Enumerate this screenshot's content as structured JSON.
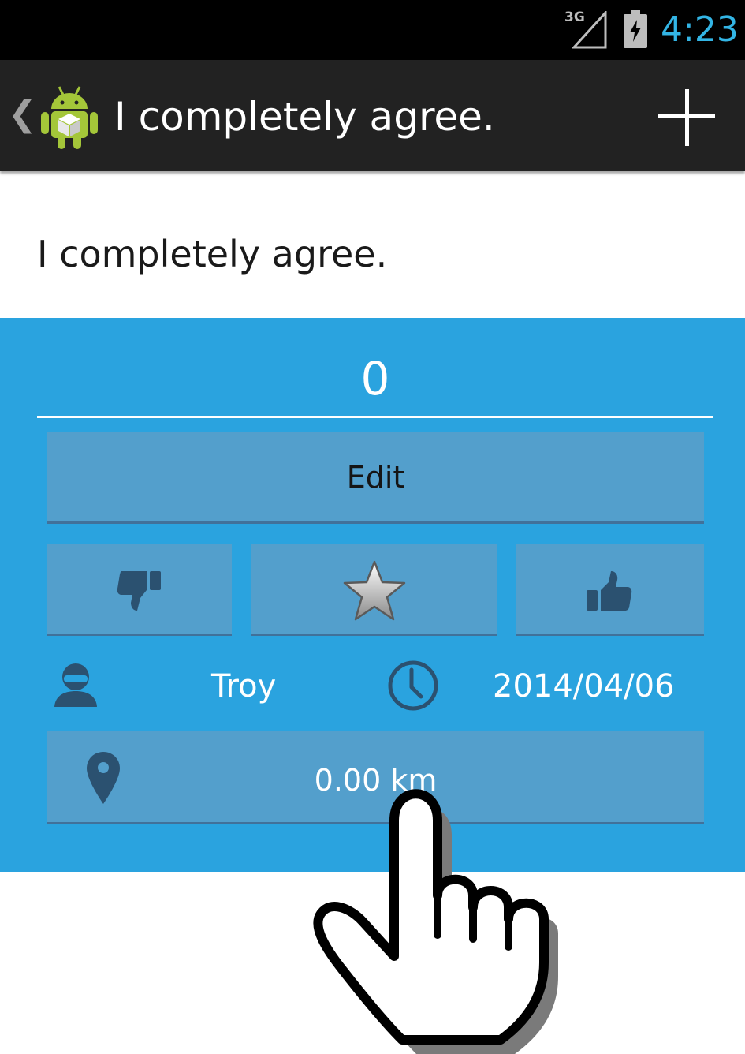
{
  "status_bar": {
    "network": "3G",
    "time": "4:23"
  },
  "action_bar": {
    "up_icon": "chevron-left-icon",
    "app_icon": "android-icon",
    "title": "I completely agree.",
    "add_icon": "plus-icon"
  },
  "post": {
    "text": "I completely agree."
  },
  "panel": {
    "background": "#2aa3df",
    "score": "0",
    "edit_label": "Edit",
    "vote_down_icon": "thumbs-down-icon",
    "favorite_icon": "star-icon",
    "vote_up_icon": "thumbs-up-icon",
    "author_icon": "user-icon",
    "author": "Troy",
    "date_icon": "clock-icon",
    "date": "2014/04/06",
    "location_icon": "map-pin-icon",
    "distance": "0.00 km"
  },
  "overlay": {
    "icon": "pointing-hand-icon"
  }
}
